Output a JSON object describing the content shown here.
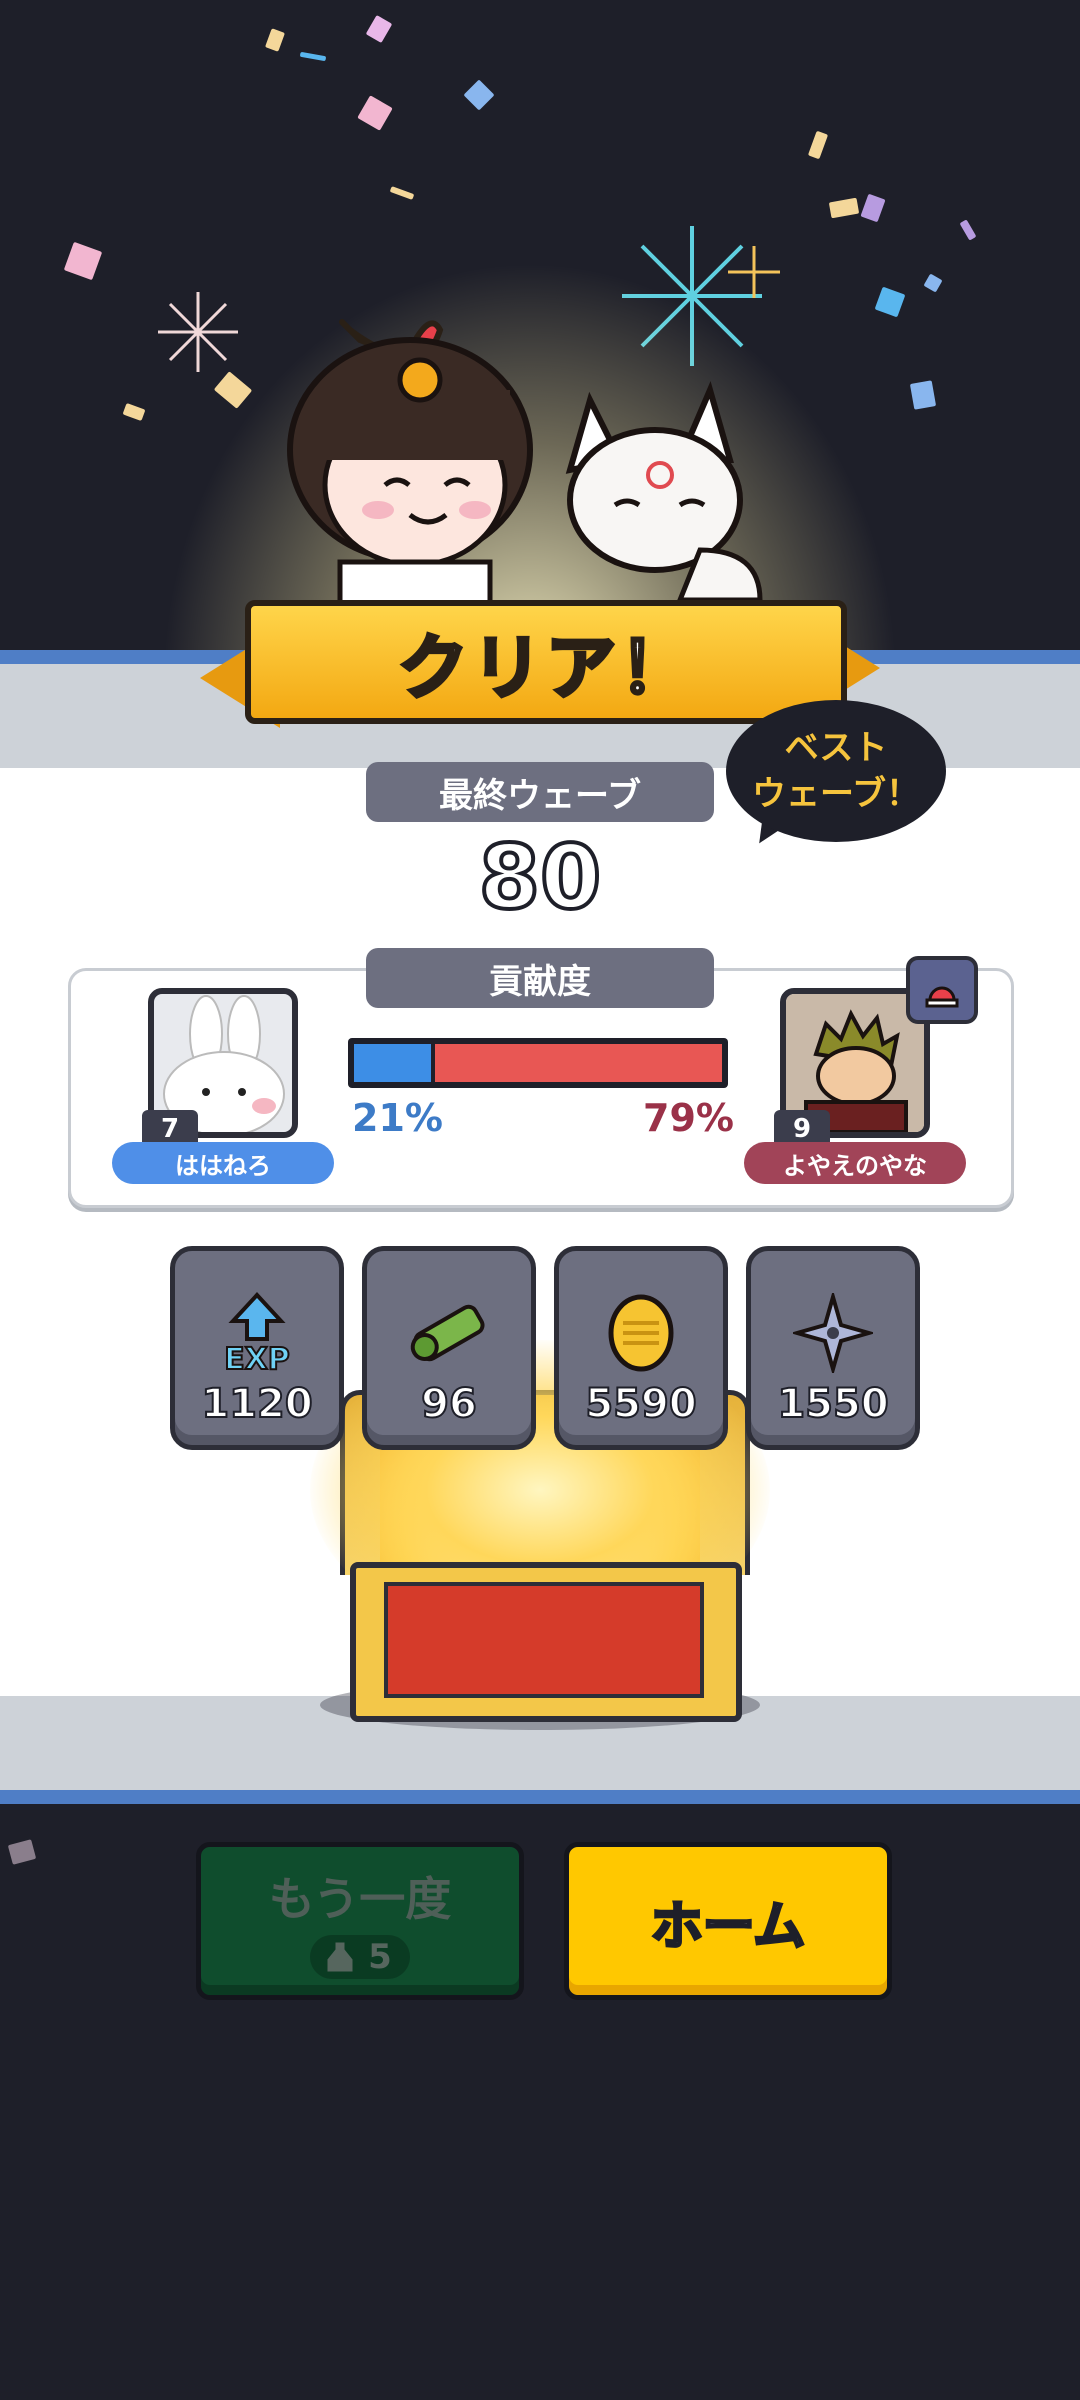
{
  "banner": {
    "title": "クリア！"
  },
  "final_wave": {
    "label": "最終ウェーブ",
    "value": "80"
  },
  "best_bubble": {
    "line1": "ベスト",
    "line2": "ウェーブ！"
  },
  "contribution": {
    "label": "貢献度",
    "left_player": {
      "name": "ははねろ",
      "level": "7",
      "percent": "21%"
    },
    "right_player": {
      "name": "よやえのやな",
      "level": "9",
      "percent": "79%"
    },
    "left_share": 0.21
  },
  "rewards": [
    {
      "icon": "exp-icon",
      "value": "1120"
    },
    {
      "icon": "scroll-icon",
      "value": "96"
    },
    {
      "icon": "gold-coin-icon",
      "value": "5590"
    },
    {
      "icon": "shuriken-icon",
      "value": "1550"
    }
  ],
  "buttons": {
    "retry_label": "もう一度",
    "retry_cost": "5",
    "home_label": "ホーム"
  },
  "colors": {
    "background": "#1e1f29",
    "accent_yellow": "#ffc800",
    "blue_team": "#3d8ee6",
    "red_team": "#e85754"
  }
}
